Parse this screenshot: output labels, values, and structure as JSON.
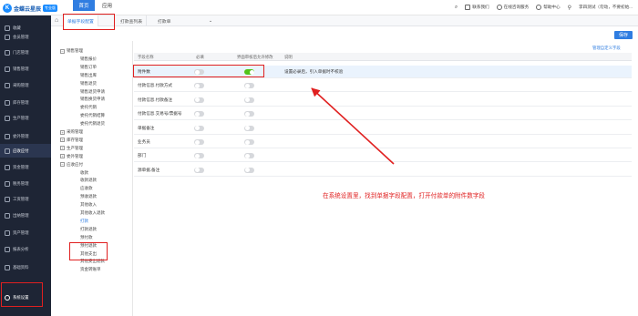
{
  "brand": {
    "logo_text": "金蝶云星辰",
    "badge": "专业版"
  },
  "top_nav": {
    "home": "首页",
    "app": "应用"
  },
  "top_right": {
    "contact": "联系我们",
    "feedback": "在线咨询服务",
    "help": "帮助中心",
    "user": "李四测试（勿动，不要初始..."
  },
  "sidebar": {
    "items": [
      "收藏",
      "会员管理",
      "门店管理",
      "销售管理",
      "采购管理",
      "库存管理",
      "生产管理",
      "委外管理",
      "应收应付",
      "资金管理",
      "税务管理",
      "工资管理",
      "出纳管理",
      "资产管理",
      "报表分析",
      "基础资料",
      "系统设置"
    ]
  },
  "tabs": {
    "first": "单据字段配置",
    "second": "打款查列表",
    "third": "打款单"
  },
  "toolbar": {
    "save": "保存",
    "manage_link": "管理自定义字段"
  },
  "tree": {
    "groups": [
      {
        "label": "销售管理",
        "expander": "−"
      },
      {
        "label": "采购管理",
        "expander": "+"
      },
      {
        "label": "库存管理",
        "expander": "+"
      },
      {
        "label": "生产管理",
        "expander": "+"
      },
      {
        "label": "委外管理",
        "expander": "+"
      },
      {
        "label": "应收应付",
        "expander": "−"
      }
    ],
    "sales_children": [
      "销售报价",
      "销售订单",
      "销售出库",
      "销售退货",
      "销售退货申请",
      "销售换货申请",
      "委托代销",
      "委托代销结算",
      "委托代销退货"
    ],
    "ar_children": [
      "收款",
      "收款退款",
      "应收款",
      "预收退款",
      "其他收入",
      "其他收入退款",
      "打款",
      "打款退款",
      "预付款",
      "预付退款",
      "其他支出",
      "其他支出退款",
      "资金转账单"
    ]
  },
  "table": {
    "headers": [
      "字段名称",
      "必填",
      "界面审核后允许修改",
      "说明"
    ],
    "rows": [
      {
        "name": "附件数",
        "required": false,
        "editable": true,
        "note": "设置必录后，引入单据时不校验"
      },
      {
        "name": "付款信息.付款方式",
        "required": false,
        "editable": false,
        "note": ""
      },
      {
        "name": "付款信息.付款备注",
        "required": false,
        "editable": false,
        "note": ""
      },
      {
        "name": "付款信息.交易号/票据号",
        "required": false,
        "editable": false,
        "note": ""
      },
      {
        "name": "单据备注",
        "required": false,
        "editable": false,
        "note": ""
      },
      {
        "name": "业务员",
        "required": false,
        "editable": false,
        "note": ""
      },
      {
        "name": "部门",
        "required": false,
        "editable": false,
        "note": ""
      },
      {
        "name": "源单据.备注",
        "required": false,
        "editable": false,
        "note": ""
      }
    ]
  },
  "annotation": {
    "text": "在系统设置里，找到单据字段配置，打开付款单的附件数字段"
  },
  "colors": {
    "primary": "#2f7de1",
    "sidebar_bg": "#1e2535",
    "toggle_on": "#52c41a",
    "annotation_red": "#e02020"
  }
}
